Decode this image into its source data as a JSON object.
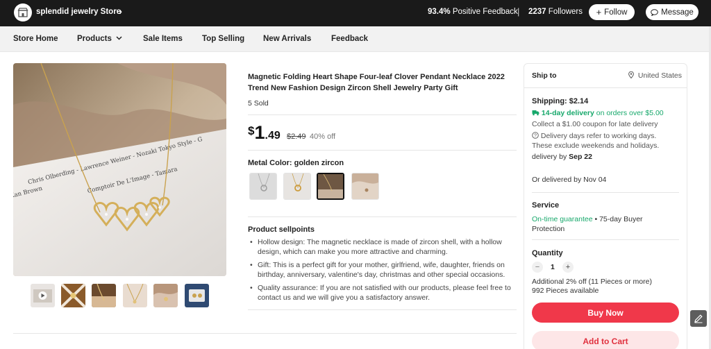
{
  "topbar": {
    "store_name": "splendid jewelry Store",
    "positive_feedback_value": "93.4%",
    "positive_feedback_label": "Positive Feedback",
    "separator": "|",
    "followers_value": "2237",
    "followers_label": "Followers",
    "follow_label": "Follow",
    "message_label": "Message"
  },
  "nav": {
    "items": [
      "Store Home",
      "Products",
      "Sale Items",
      "Top Selling",
      "New Arrivals",
      "Feedback"
    ]
  },
  "product": {
    "title": "Magnetic Folding Heart Shape Four-leaf Clover Pendant Necklace 2022 Trend New Fashion Design Zircon Shell Jewelry Party Gift",
    "sold": "5 Sold",
    "price_currency": "$",
    "price_integer": "1",
    "price_decimal": ".49",
    "original_price": "$2.49",
    "discount": "40% off",
    "image_text_1": "Chris Olberding - Lawrence Weiner - Nozaki Tokyo Style - G",
    "image_text_2": "Kan Brown",
    "image_text_3": "Comptoir De L'Image - Tamara",
    "metal_color_label": "Metal Color: golden zircon",
    "selected_swatch_index": 2,
    "sellpoints_title": "Product sellpoints",
    "sellpoints": [
      "Hollow design: The magnetic necklace is made of zircon shell, with a hollow design, which can make you more attractive and charming.",
      "Gift: This is a perfect gift for your mother, girlfriend, wife, daughter, friends on birthday, anniversary, valentine's day, christmas and other special occasions.",
      "Quality assurance: If you are not satisfied with our products, please feel free to contact us and we will give you a satisfactory answer."
    ]
  },
  "panel": {
    "ship_to_label": "Ship to",
    "ship_to_value": "United States",
    "shipping": "Shipping: $2.14",
    "delivery_highlight": "14-day delivery",
    "delivery_rest": "on orders over $5.00",
    "coupon": "Collect a $1.00 coupon for late delivery",
    "working_days_1": "Delivery days refer to working days.",
    "working_days_2": "These exclude weekends and holidays.",
    "delivery_by_prefix": "delivery by",
    "delivery_by_date": "Sep 22",
    "alt_delivery": "Or delivered by Nov 04",
    "service_title": "Service",
    "service_highlight": "On-time guarantee",
    "service_rest_1": " • 75-day Buyer",
    "service_rest_2": "Protection",
    "quantity_title": "Quantity",
    "quantity_minus": "−",
    "quantity_value": "1",
    "quantity_plus": "+",
    "additional_off": "Additional 2% off (11 Pieces or more)",
    "available": "992 Pieces available",
    "buy_now": "Buy Now",
    "add_to_cart": "Add to Cart"
  },
  "colors": {
    "topbar_bg": "#1a1a1a",
    "buy_now": "#f0384a",
    "add_to_cart_bg": "#fde6e7",
    "green": "#17a86b"
  }
}
